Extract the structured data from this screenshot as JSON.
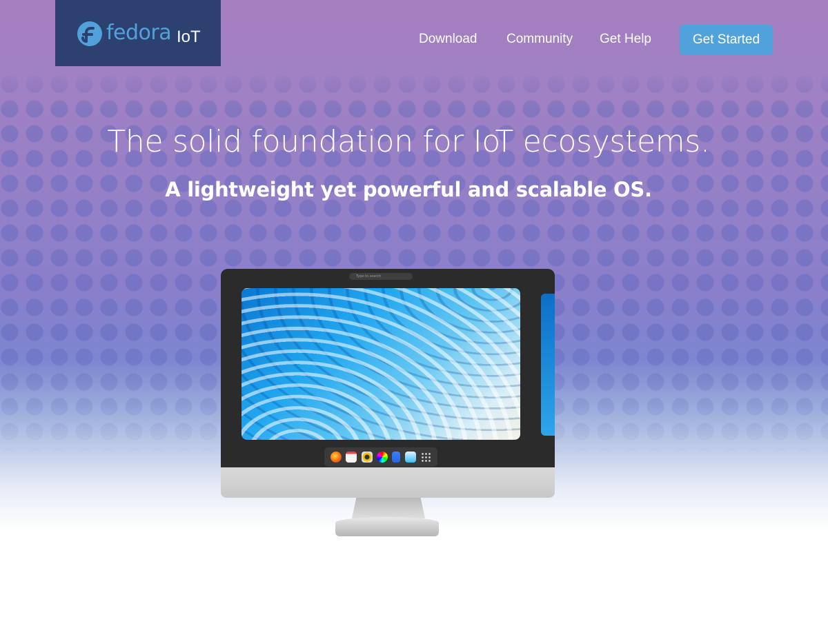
{
  "brand": {
    "logo_word": "fedora",
    "product": "IoT",
    "icon": "fedora-logo-icon",
    "colors": {
      "brand_bg": "#2c4170",
      "logo_blue": "#51a2da"
    }
  },
  "nav": {
    "links": [
      "Download",
      "Community",
      "Get Help"
    ],
    "cta": "Get Started",
    "cta_color": "#51a2da"
  },
  "hero": {
    "headline": "The solid foundation for IoT ecosystems.",
    "subhead": "A lightweight yet powerful and scalable OS."
  },
  "device": {
    "search_placeholder": "Type to search",
    "dock_apps": [
      "firefox-icon",
      "calendar-icon",
      "settings-icon",
      "software-icon",
      "files-icon",
      "store-icon",
      "app-grid-icon"
    ]
  }
}
